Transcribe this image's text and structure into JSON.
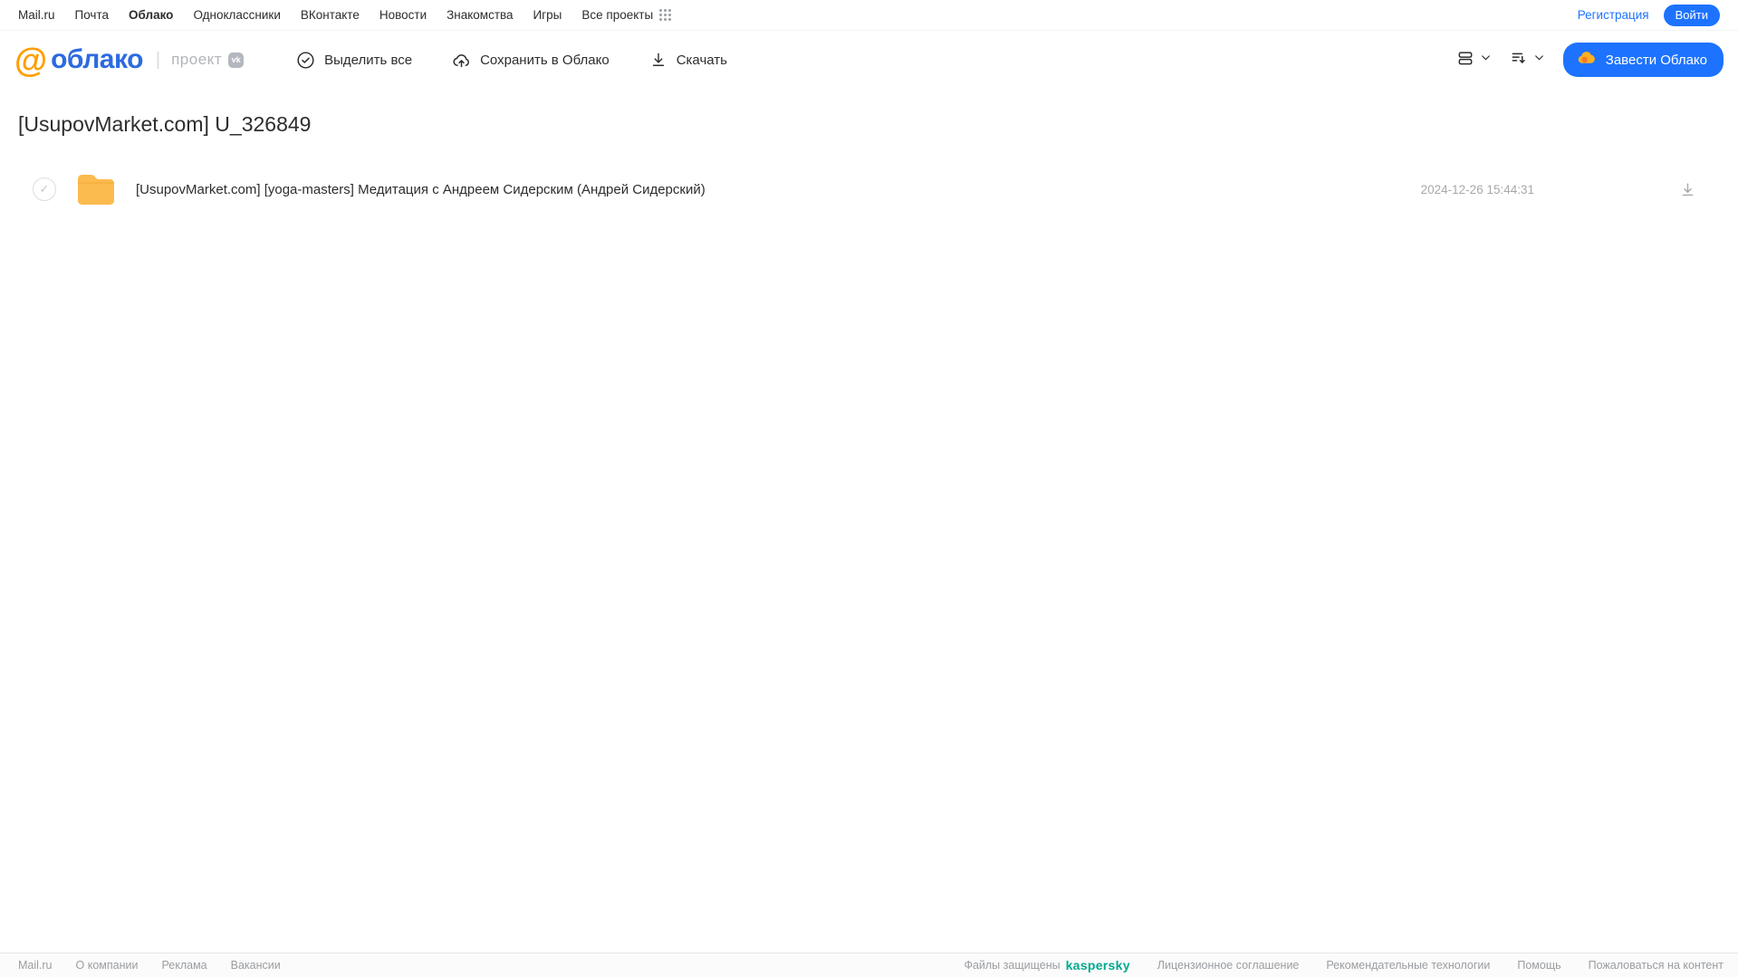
{
  "topnav": {
    "items": [
      "Mail.ru",
      "Почта",
      "Облако",
      "Одноклассники",
      "ВКонтакте",
      "Новости",
      "Знакомства",
      "Игры",
      "Все проекты"
    ],
    "registration": "Регистрация",
    "login": "Войти"
  },
  "header": {
    "logo_at": "@",
    "logo_text": "облако",
    "logo_sep": "|",
    "project_label": "проект",
    "vk_badge": "vk",
    "toolbar": {
      "select_all": "Выделить все",
      "save_to_cloud": "Сохранить в Облако",
      "download": "Скачать"
    },
    "get_cloud_button": "Завести Облако"
  },
  "page": {
    "title": "[UsupovMarket.com] U_326849"
  },
  "files": [
    {
      "name": "[UsupovMarket.com] [yoga-masters] Медитация с Андреем Сидерским (Андрей Сидерский)",
      "date": "2024-12-26 15:44:31",
      "check": "✓"
    }
  ],
  "footer": {
    "left_links": [
      "Mail.ru",
      "О компании",
      "Реклама",
      "Вакансии"
    ],
    "protected_text": "Файлы защищены",
    "kaspersky": "kaspersky",
    "right_links": [
      "Лицензионное соглашение",
      "Рекомендательные технологии",
      "Помощь",
      "Пожаловаться на контент"
    ]
  },
  "colors": {
    "accent_blue": "#1d73ff",
    "logo_orange": "#ff9e00",
    "logo_blue": "#2d6ae0",
    "folder_yellow": "#fbbb4e",
    "kaspersky_green": "#00a88e"
  }
}
